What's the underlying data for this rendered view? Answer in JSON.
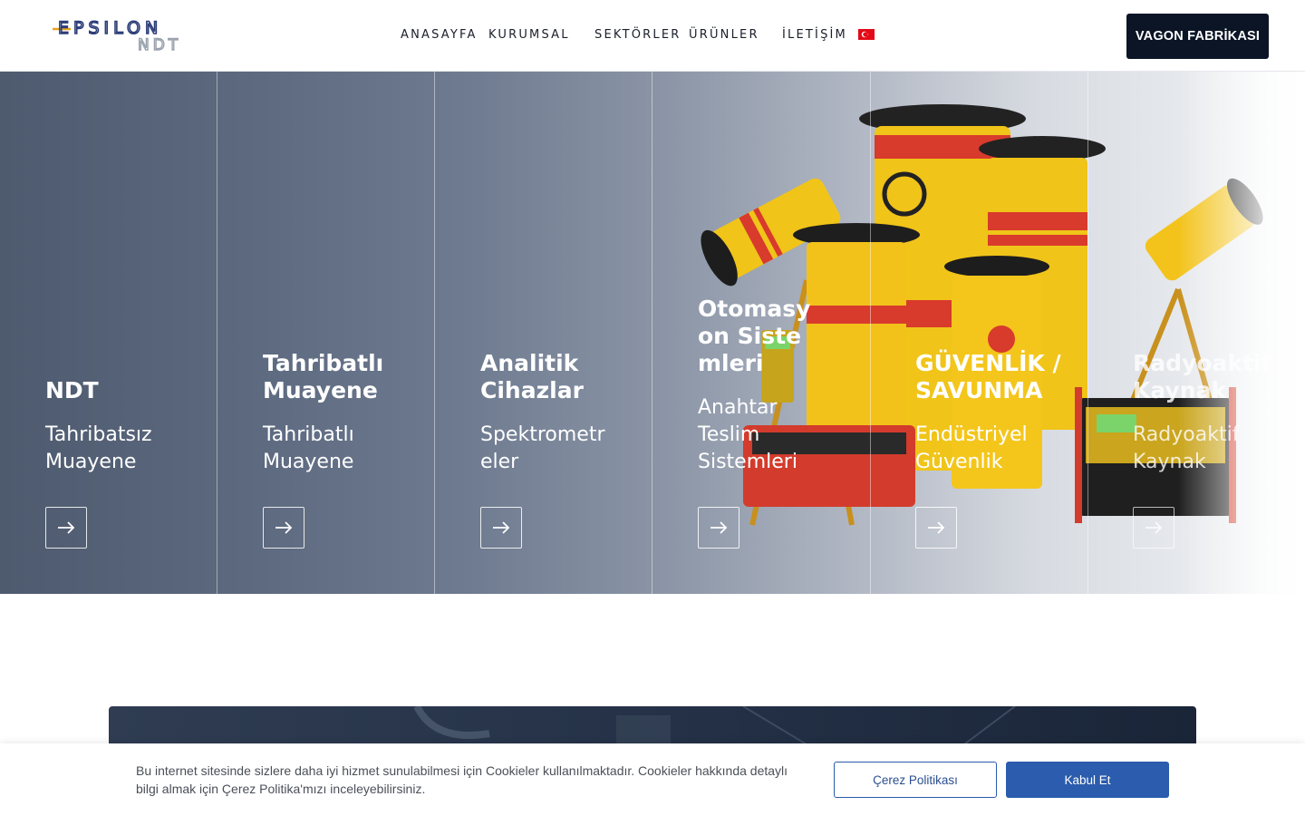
{
  "header": {
    "logo_top": "EPSILON",
    "logo_bottom": "NDT",
    "nav": [
      "ANASAYFA",
      "KURUMSAL",
      "SEKTÖRLER",
      "ÜRÜNLER",
      "İLETİŞİM"
    ],
    "language_flag": "turkey-flag-icon",
    "cta_label": "VAGON FABRİKASI"
  },
  "hero": {
    "columns": [
      {
        "title": "NDT",
        "subtitle": "Tahribatsız Muayene"
      },
      {
        "title": "Tahribatlı Muayene",
        "subtitle": "Tahribatlı Muayene"
      },
      {
        "title": "Analitik Cihazlar",
        "subtitle": "Spektrometreler"
      },
      {
        "title": "Otomasyon Sistemleri",
        "subtitle": "Anahtar Teslim Sistemleri"
      },
      {
        "title": "GÜVENLİK / SAVUNMA",
        "subtitle": "Endüstriyel Güvenlik"
      },
      {
        "title": "Radyoaktif Kaynak",
        "subtitle": "Radyoaktif Kaynak"
      }
    ],
    "arrow_icon": "arrow-right-icon"
  },
  "cookie": {
    "text": "Bu internet sitesinde sizlere daha iyi hizmet sunulabilmesi için Cookieler kullanılmaktadır. Cookieler hakkında detaylı bilgi almak için Çerez Politika'mızı inceleyebilirsiniz.",
    "policy_label": "Çerez Politikası",
    "accept_label": "Kabul Et"
  },
  "colors": {
    "brand_dark": "#0b1526",
    "accent_blue": "#2b5cad",
    "logo_orange": "#e8a21d"
  }
}
